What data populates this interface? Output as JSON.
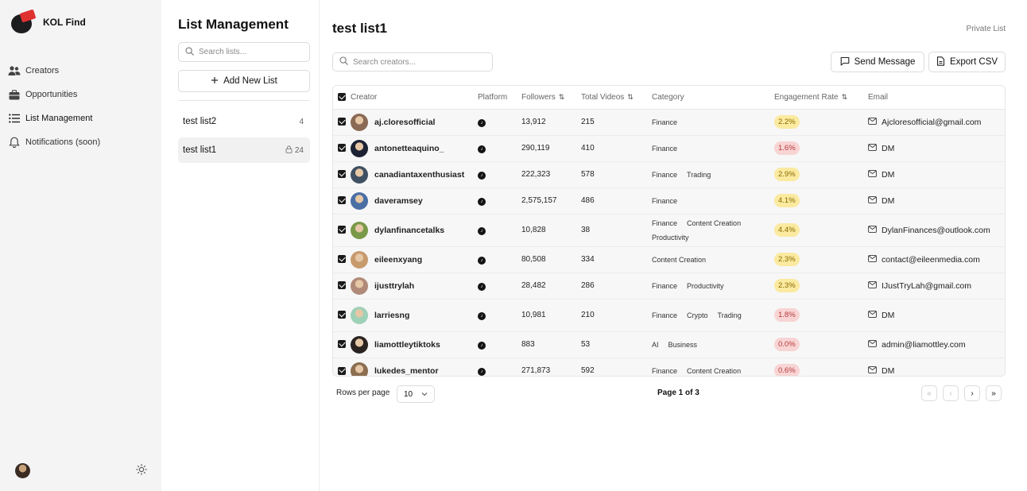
{
  "brand": {
    "name": "KOL Find"
  },
  "nav": [
    {
      "label": "Creators",
      "icon": "users-icon"
    },
    {
      "label": "Opportunities",
      "icon": "briefcase-icon"
    },
    {
      "label": "List Management",
      "icon": "list-icon"
    },
    {
      "label": "Notifications (soon)",
      "icon": "bell-icon"
    }
  ],
  "lists_panel": {
    "title": "List Management",
    "search_placeholder": "Search lists...",
    "add_label": "Add New List",
    "lists": [
      {
        "name": "test list2",
        "count": "4",
        "private": false
      },
      {
        "name": "test list1",
        "count": "24",
        "private": true
      }
    ]
  },
  "main": {
    "title": "test list1",
    "privacy": "Private List",
    "search_placeholder": "Search creators...",
    "send_message_label": "Send Message",
    "export_label": "Export CSV",
    "columns": [
      "Creator",
      "Platform",
      "Followers",
      "Total Videos",
      "Category",
      "Engagement Rate",
      "Email"
    ],
    "rows": [
      {
        "creator": "aj.cloresofficial",
        "followers": "13,912",
        "videos": "215",
        "categories": [
          "Finance"
        ],
        "engagement": "2.2%",
        "eng_color": "yellow",
        "email": "Ajcloresofficial@gmail.com",
        "avatar": "#8a6a55"
      },
      {
        "creator": "antonetteaquino_",
        "followers": "290,119",
        "videos": "410",
        "categories": [
          "Finance"
        ],
        "engagement": "1.6%",
        "eng_color": "red",
        "email": "DM",
        "avatar": "#1c2233"
      },
      {
        "creator": "canadiantaxenthusiast",
        "followers": "222,323",
        "videos": "578",
        "categories": [
          "Finance",
          "Trading"
        ],
        "engagement": "2.9%",
        "eng_color": "yellow",
        "email": "DM",
        "avatar": "#3f5063"
      },
      {
        "creator": "daveramsey",
        "followers": "2,575,157",
        "videos": "486",
        "categories": [
          "Finance"
        ],
        "engagement": "4.1%",
        "eng_color": "yellow",
        "email": "DM",
        "avatar": "#4a6fa5"
      },
      {
        "creator": "dylanfinancetalks",
        "followers": "10,828",
        "videos": "38",
        "categories": [
          "Finance",
          "Content Creation",
          "Productivity"
        ],
        "engagement": "4.4%",
        "eng_color": "yellow",
        "email": "DylanFinances@outlook.com",
        "avatar": "#7a9a4a"
      },
      {
        "creator": "eileenxyang",
        "followers": "80,508",
        "videos": "334",
        "categories": [
          "Content Creation"
        ],
        "engagement": "2.3%",
        "eng_color": "yellow",
        "email": "contact@eileenmedia.com",
        "avatar": "#c79a6e"
      },
      {
        "creator": "ijusttrylah",
        "followers": "28,482",
        "videos": "286",
        "categories": [
          "Finance",
          "Productivity"
        ],
        "engagement": "2.3%",
        "eng_color": "yellow",
        "email": "IJustTryLah@gmail.com",
        "avatar": "#b08a78"
      },
      {
        "creator": "larriesng",
        "followers": "10,981",
        "videos": "210",
        "categories": [
          "Finance",
          "Crypto",
          "Trading"
        ],
        "engagement": "1.8%",
        "eng_color": "red",
        "email": "DM",
        "avatar": "#9fd0b8"
      },
      {
        "creator": "liamottleytiktoks",
        "followers": "883",
        "videos": "53",
        "categories": [
          "AI",
          "Business"
        ],
        "engagement": "0.0%",
        "eng_color": "red",
        "email": "admin@liamottley.com",
        "avatar": "#2a2320"
      },
      {
        "creator": "lukedes_mentor",
        "followers": "271,873",
        "videos": "592",
        "categories": [
          "Finance",
          "Content Creation"
        ],
        "engagement": "0.6%",
        "eng_color": "red",
        "email": "DM",
        "avatar": "#8c6e50"
      }
    ],
    "pagination": {
      "rows_label": "Rows per page",
      "rows_value": "10",
      "page_info": "Page 1 of 3",
      "first": "«",
      "prev": "‹",
      "next": "›",
      "last": "»"
    }
  }
}
